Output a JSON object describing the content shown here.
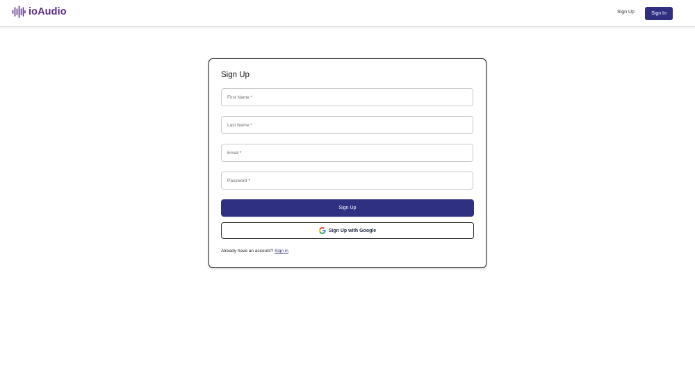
{
  "header": {
    "brand": "ioAudio",
    "nav": {
      "signup": "Sign Up",
      "signin": "Sign In"
    }
  },
  "form": {
    "title": "Sign Up",
    "fields": [
      {
        "placeholder": "First Name *",
        "value": ""
      },
      {
        "placeholder": "Last Name *",
        "value": ""
      },
      {
        "placeholder": "Email *",
        "value": ""
      },
      {
        "placeholder": "Password *",
        "value": ""
      }
    ],
    "submit_label": "Sign Up",
    "google_label": "Sign Up with Google",
    "footer_text": "Already have an account?",
    "footer_link": "Sign in"
  },
  "colors": {
    "brand": "#5b2a86",
    "primary": "#2f2e81"
  }
}
